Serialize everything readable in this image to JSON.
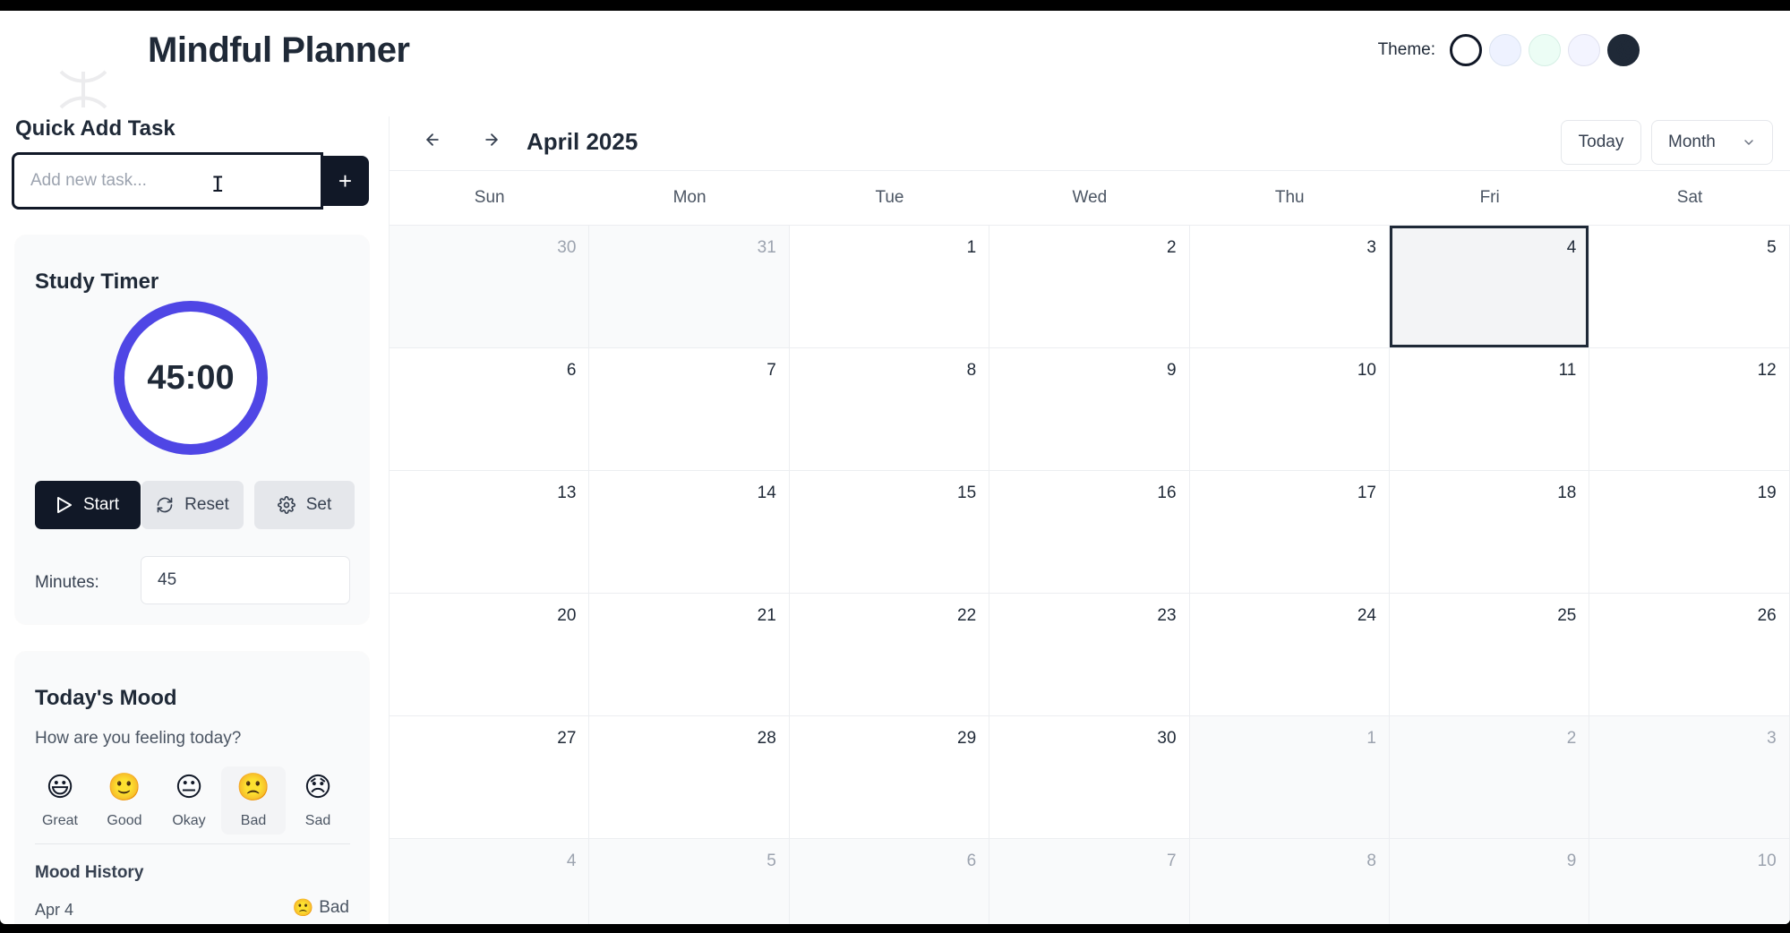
{
  "app": {
    "title": "Mindful Planner",
    "theme_label": "Theme:",
    "themes": [
      {
        "name": "white",
        "color": "#ffffff",
        "border": "#111827"
      },
      {
        "name": "blue",
        "color": "#eef2ff",
        "border": "#dbe3f0"
      },
      {
        "name": "mint",
        "color": "#ecfdf5",
        "border": "#d6efe5"
      },
      {
        "name": "lavender",
        "color": "#f3f4ff",
        "border": "#e0e1ef"
      },
      {
        "name": "dark",
        "color": "#1f2937",
        "border": "#1f2937"
      }
    ],
    "settings_icon": "gear-icon"
  },
  "quick_add": {
    "title": "Quick Add Task",
    "placeholder": "Add new task...",
    "add_label": "+"
  },
  "timer": {
    "title": "Study Timer",
    "display": "45:00",
    "start_label": "Start",
    "reset_label": "Reset",
    "set_label": "Set",
    "minutes_label": "Minutes:",
    "minutes_value": "45",
    "ring_color": "#4f46e5"
  },
  "mood": {
    "title": "Today's Mood",
    "question": "How are you feeling today?",
    "options": [
      {
        "emoji": "😃",
        "label": "Great"
      },
      {
        "emoji": "🙂",
        "label": "Good"
      },
      {
        "emoji": "😐",
        "label": "Okay"
      },
      {
        "emoji": "🙁",
        "label": "Bad"
      },
      {
        "emoji": "😞",
        "label": "Sad"
      }
    ],
    "selected": "Bad",
    "history_title": "Mood History",
    "history": [
      {
        "date": "Apr 4",
        "emoji": "🙁",
        "mood": "Bad"
      }
    ]
  },
  "calendar": {
    "month_label": "April 2025",
    "today_label": "Today",
    "view_label": "Month",
    "weekdays": [
      "Sun",
      "Mon",
      "Tue",
      "Wed",
      "Thu",
      "Fri",
      "Sat"
    ],
    "days": [
      {
        "n": "30",
        "outside": true
      },
      {
        "n": "31",
        "outside": true
      },
      {
        "n": "1"
      },
      {
        "n": "2"
      },
      {
        "n": "3"
      },
      {
        "n": "4",
        "today": true
      },
      {
        "n": "5"
      },
      {
        "n": "6"
      },
      {
        "n": "7"
      },
      {
        "n": "8"
      },
      {
        "n": "9"
      },
      {
        "n": "10"
      },
      {
        "n": "11"
      },
      {
        "n": "12"
      },
      {
        "n": "13"
      },
      {
        "n": "14"
      },
      {
        "n": "15"
      },
      {
        "n": "16"
      },
      {
        "n": "17"
      },
      {
        "n": "18"
      },
      {
        "n": "19"
      },
      {
        "n": "20"
      },
      {
        "n": "21"
      },
      {
        "n": "22"
      },
      {
        "n": "23"
      },
      {
        "n": "24"
      },
      {
        "n": "25"
      },
      {
        "n": "26"
      },
      {
        "n": "27"
      },
      {
        "n": "28"
      },
      {
        "n": "29"
      },
      {
        "n": "30"
      },
      {
        "n": "1",
        "outside": true
      },
      {
        "n": "2",
        "outside": true
      },
      {
        "n": "3",
        "outside": true
      },
      {
        "n": "4",
        "outside": true
      },
      {
        "n": "5",
        "outside": true
      },
      {
        "n": "6",
        "outside": true
      },
      {
        "n": "7",
        "outside": true
      },
      {
        "n": "8",
        "outside": true
      },
      {
        "n": "9",
        "outside": true
      },
      {
        "n": "10",
        "outside": true
      }
    ]
  }
}
